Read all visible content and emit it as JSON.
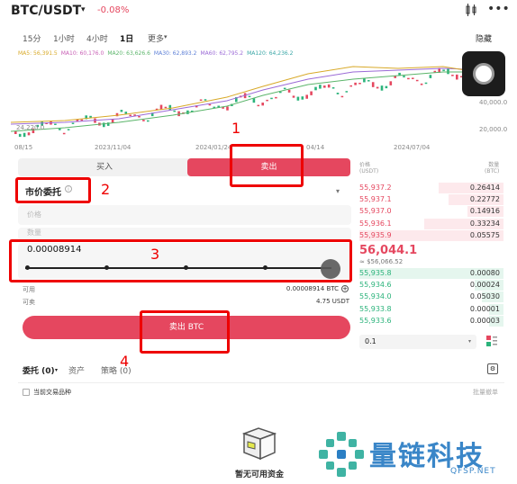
{
  "header": {
    "pair": "BTC/USDT",
    "change": "-0.08%",
    "caret": "▾"
  },
  "timeframes": [
    "15分",
    "1小时",
    "4小时",
    "1日",
    "更多"
  ],
  "hide_label": "隐藏",
  "ma_legend": [
    {
      "label": "MA5: 56,391.5",
      "color": "#d8a928"
    },
    {
      "label": "MA10: 60,176.0",
      "color": "#c85fb5"
    },
    {
      "label": "MA20: 63,626.6",
      "color": "#5bb56a"
    },
    {
      "label": "MA30: 62,893.2",
      "color": "#5c7fd6"
    },
    {
      "label": "MA60: 62,795.2",
      "color": "#9b6ad6"
    },
    {
      "label": "MA120: 64,236.2",
      "color": "#3aa6a6"
    }
  ],
  "chart": {
    "y_labels": [
      "40,000.0",
      "20,000.0"
    ],
    "low_label": "24,220.0",
    "x_labels": [
      "08/15",
      "2023/11/04",
      "2024/01/24",
      "04/14",
      "2024/07/04"
    ]
  },
  "trade": {
    "buy_tab": "买入",
    "sell_tab": "卖出",
    "order_type": "市价委托",
    "price_placeholder": "价格",
    "amount_placeholder": "数量",
    "quantity": "0.00008914",
    "available_label": "可用",
    "available_value": "0.00008914 BTC",
    "sellable_label": "可卖",
    "sellable_value": "4.75 USDT",
    "sell_button": "卖出 BTC"
  },
  "orderbook": {
    "price_header": "价格\n(USDT)",
    "qty_header": "数量\n(BTC)",
    "asks": [
      {
        "price": "55,937.2",
        "qty": "0.26414",
        "depth": 0.45
      },
      {
        "price": "55,937.1",
        "qty": "0.22772",
        "depth": 0.38
      },
      {
        "price": "55,937.0",
        "qty": "0.14916",
        "depth": 0.25
      },
      {
        "price": "55,936.1",
        "qty": "0.33234",
        "depth": 0.55
      },
      {
        "price": "55,935.9",
        "qty": "0.05575",
        "depth": 1.0
      }
    ],
    "last_price": "56,044.1",
    "last_usd": "≈ $56,066.52",
    "bids": [
      {
        "price": "55,935.8",
        "qty": "0.00080",
        "depth": 1.0
      },
      {
        "price": "55,934.6",
        "qty": "0.00024",
        "depth": 0.2
      },
      {
        "price": "55,934.0",
        "qty": "0.05030",
        "depth": 0.15
      },
      {
        "price": "55,933.8",
        "qty": "0.00001",
        "depth": 0.1
      },
      {
        "price": "55,933.6",
        "qty": "0.00003",
        "depth": 0.1
      }
    ],
    "depth_value": "0.1"
  },
  "orders": {
    "tabs": [
      "委托 (0)",
      "资产",
      "策略 (0)"
    ],
    "current_only": "当前交易品种",
    "batch_cancel": "批量撤单",
    "empty_text": "暂无可用资金"
  },
  "annotations": [
    "1",
    "2",
    "3",
    "4"
  ],
  "watermark": {
    "title": "量链科技",
    "sub": "QFSP.NET"
  }
}
